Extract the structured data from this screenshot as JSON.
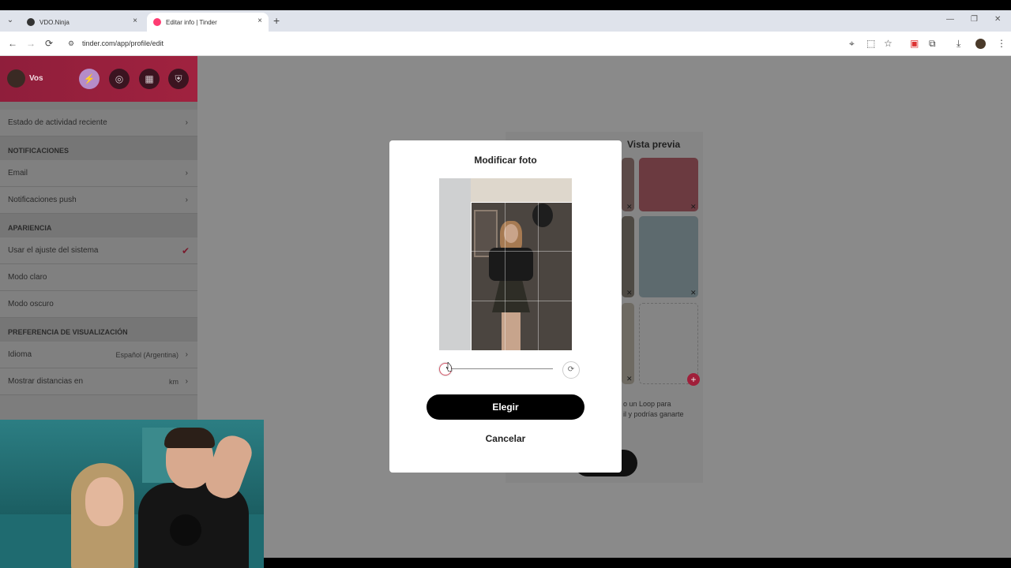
{
  "browser": {
    "tabs": [
      {
        "label": "VDO.Ninja",
        "active": false
      },
      {
        "label": "Editar info | Tinder",
        "active": true
      }
    ],
    "url": "tinder.com/app/profile/edit",
    "icons": {
      "back": "←",
      "forward": "→",
      "reload": "⟳",
      "new_tab": "+",
      "minimize": "—",
      "restore": "❐",
      "close": "✕",
      "tab_close": "×",
      "tab_menu": "⌄",
      "location": "⌖",
      "install": "⬚",
      "star": "☆",
      "extension": "▣",
      "puzzle": "⧉",
      "download": "⤓",
      "menu": "⋮",
      "tune": "⚙"
    }
  },
  "sidebar": {
    "user_name": "Vos",
    "header_buttons": [
      {
        "icon": "lightning-icon",
        "glyph": "⚡"
      },
      {
        "icon": "compass-icon",
        "glyph": "◎"
      },
      {
        "icon": "briefcase-icon",
        "glyph": "▦"
      },
      {
        "icon": "shield-icon",
        "glyph": "⛨"
      }
    ],
    "rows": {
      "recent_activity": "Estado de actividad reciente",
      "notifications_section": "NOTIFICACIONES",
      "email": "Email",
      "push": "Notificaciones push",
      "appearance_section": "APARIENCIA",
      "system_setting": "Usar el ajuste del sistema",
      "light_mode": "Modo claro",
      "dark_mode": "Modo oscuro",
      "display_section": "PREFERENCIA DE VISUALIZACIÓN",
      "language": "Idioma",
      "language_value": "Español (Argentina)",
      "distance": "Mostrar distancias en",
      "distance_value": "km"
    },
    "chevron": "›",
    "check": "✔"
  },
  "background": {
    "preview_label": "Vista previa",
    "loop_text_1": "o un Loop para",
    "loop_text_2": "il y podrías ganarte",
    "remove_glyph": "✕",
    "add_glyph": "+"
  },
  "modal": {
    "title": "Modificar foto",
    "choose_label": "Elegir",
    "cancel_label": "Cancelar",
    "rotate_glyph": "⟳",
    "zoom_level": 0.0
  },
  "colors": {
    "accent": "#fe3c72",
    "header_gradient": "#a0223f"
  }
}
